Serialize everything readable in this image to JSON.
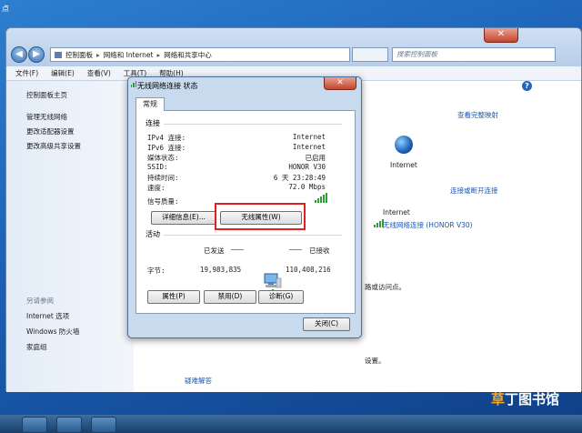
{
  "desktop": {
    "edge_text": "点"
  },
  "window": {
    "close_glyph": "✕",
    "address": {
      "crumbs": [
        "控制面板",
        "网络和 Internet",
        "网络和共享中心"
      ],
      "sep": "▸"
    },
    "search_placeholder": "搜索控制面板",
    "menu": [
      "文件(F)",
      "编辑(E)",
      "查看(V)",
      "工具(T)",
      "帮助(H)"
    ],
    "help_glyph": "?"
  },
  "sidebar": {
    "home": "控制面板主页",
    "links": [
      "管理无线网络",
      "更改适配器设置",
      "更改高级共享设置"
    ],
    "see_also_title": "另请参阅",
    "see_also": [
      "Internet 选项",
      "Windows 防火墙",
      "家庭组"
    ]
  },
  "main": {
    "view_full_map": "查看完整映射",
    "internet_label": "Internet",
    "connect_disconnect": "连接或断开连接",
    "access_type_value": "Internet",
    "connection_value": "无线网络连接 (HONOR V30)",
    "partial_texts": [
      "路或访问点。",
      "设置。"
    ],
    "troubleshoot": "疑难解答"
  },
  "dialog": {
    "title": "无线网络连接 状态",
    "close_glyph": "✕",
    "tab": "常规",
    "connection_section": "连接",
    "rows": [
      {
        "label": "IPv4 连接:",
        "value": "Internet"
      },
      {
        "label": "IPv6 连接:",
        "value": "Internet"
      },
      {
        "label": "媒体状态:",
        "value": "已启用"
      },
      {
        "label": "SSID:",
        "value": "HONOR V30"
      },
      {
        "label": "持续时间:",
        "value": "6 天 23:28:49"
      },
      {
        "label": "速度:",
        "value": "72.0 Mbps"
      }
    ],
    "signal_label": "信号质量:",
    "details_button": "详细信息(E)...",
    "wireless_props_button": "无线属性(W)",
    "activity_section": "活动",
    "sent_label": "已发送",
    "received_label": "已接收",
    "bytes_label": "字节:",
    "bytes_sent": "19,983,835",
    "bytes_received": "110,408,216",
    "properties_button": "属性(P)",
    "disable_button": "禁用(D)",
    "diagnose_button": "诊断(G)",
    "close_button": "关闭(C)",
    "signal_strength_bars": 5
  },
  "watermark": {
    "part1": "草",
    "part2": "丁图书馆"
  },
  "colors": {
    "accent_link": "#1a56b0",
    "highlight_border": "#e02020",
    "signal": "#2e9e3a"
  }
}
